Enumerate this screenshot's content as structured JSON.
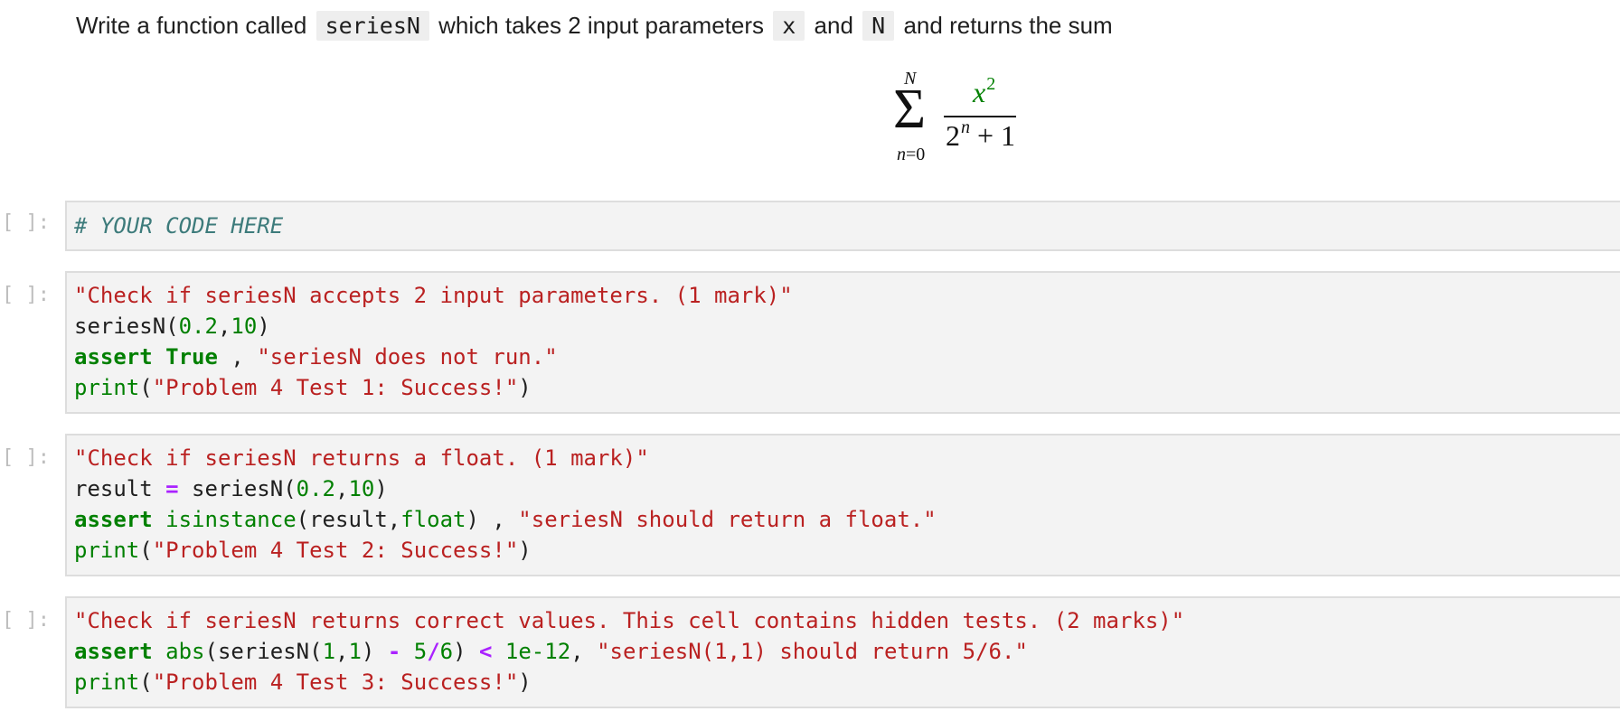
{
  "markdown": {
    "text_1": "Write a function called",
    "code_1": "seriesN",
    "text_2": "which takes 2 input parameters",
    "code_2": "x",
    "text_3": "and",
    "code_3": "N",
    "text_4": "and returns the sum"
  },
  "formula": {
    "sigma": "Σ",
    "upper_limit": "N",
    "lower_limit_var": "n",
    "lower_limit_eq": "=0",
    "numerator_base": "x",
    "numerator_exp": "2",
    "denominator_base": "2",
    "denominator_exp": "n",
    "denominator_rest": "+ 1"
  },
  "cells": [
    {
      "prompt": "[ ]:",
      "lines": [
        {
          "tokens": [
            {
              "t": "# YOUR CODE HERE",
              "c": "cm"
            }
          ]
        }
      ]
    },
    {
      "prompt": "[ ]:",
      "lines": [
        {
          "tokens": [
            {
              "t": "\"Check if seriesN accepts 2 input parameters. (1 mark)\"",
              "c": "str"
            }
          ]
        },
        {
          "tokens": [
            {
              "t": "seriesN(",
              "c": ""
            },
            {
              "t": "0.2",
              "c": "num"
            },
            {
              "t": ",",
              "c": ""
            },
            {
              "t": "10",
              "c": "num"
            },
            {
              "t": ")",
              "c": ""
            }
          ]
        },
        {
          "tokens": [
            {
              "t": "assert",
              "c": "kw"
            },
            {
              "t": " ",
              "c": ""
            },
            {
              "t": "True",
              "c": "kw"
            },
            {
              "t": " , ",
              "c": ""
            },
            {
              "t": "\"seriesN does not run.\"",
              "c": "str"
            }
          ]
        },
        {
          "tokens": [
            {
              "t": "print",
              "c": "bi"
            },
            {
              "t": "(",
              "c": ""
            },
            {
              "t": "\"Problem 4 Test 1: Success!\"",
              "c": "str"
            },
            {
              "t": ")",
              "c": ""
            }
          ]
        }
      ]
    },
    {
      "prompt": "[ ]:",
      "lines": [
        {
          "tokens": [
            {
              "t": "\"Check if seriesN returns a float. (1 mark)\"",
              "c": "str"
            }
          ]
        },
        {
          "tokens": [
            {
              "t": "result ",
              "c": ""
            },
            {
              "t": "=",
              "c": "op"
            },
            {
              "t": " seriesN(",
              "c": ""
            },
            {
              "t": "0.2",
              "c": "num"
            },
            {
              "t": ",",
              "c": ""
            },
            {
              "t": "10",
              "c": "num"
            },
            {
              "t": ")",
              "c": ""
            }
          ]
        },
        {
          "tokens": [
            {
              "t": "assert",
              "c": "kw"
            },
            {
              "t": " ",
              "c": ""
            },
            {
              "t": "isinstance",
              "c": "bi"
            },
            {
              "t": "(result,",
              "c": ""
            },
            {
              "t": "float",
              "c": "bi"
            },
            {
              "t": ") , ",
              "c": ""
            },
            {
              "t": "\"seriesN should return a float.\"",
              "c": "str"
            }
          ]
        },
        {
          "tokens": [
            {
              "t": "print",
              "c": "bi"
            },
            {
              "t": "(",
              "c": ""
            },
            {
              "t": "\"Problem 4 Test 2: Success!\"",
              "c": "str"
            },
            {
              "t": ")",
              "c": ""
            }
          ]
        }
      ]
    },
    {
      "prompt": "[ ]:",
      "lines": [
        {
          "tokens": [
            {
              "t": "\"Check if seriesN returns correct values. This cell contains hidden tests. (2 marks)\"",
              "c": "str"
            }
          ]
        },
        {
          "tokens": [
            {
              "t": "assert",
              "c": "kw"
            },
            {
              "t": " ",
              "c": ""
            },
            {
              "t": "abs",
              "c": "bi"
            },
            {
              "t": "(seriesN(",
              "c": ""
            },
            {
              "t": "1",
              "c": "num"
            },
            {
              "t": ",",
              "c": ""
            },
            {
              "t": "1",
              "c": "num"
            },
            {
              "t": ") ",
              "c": ""
            },
            {
              "t": "-",
              "c": "op"
            },
            {
              "t": " ",
              "c": ""
            },
            {
              "t": "5",
              "c": "num"
            },
            {
              "t": "/",
              "c": "op"
            },
            {
              "t": "6",
              "c": "num"
            },
            {
              "t": ") ",
              "c": ""
            },
            {
              "t": "<",
              "c": "op"
            },
            {
              "t": " ",
              "c": ""
            },
            {
              "t": "1e-12",
              "c": "num"
            },
            {
              "t": ", ",
              "c": ""
            },
            {
              "t": "\"seriesN(1,1) should return 5/6.\"",
              "c": "str"
            }
          ]
        },
        {
          "tokens": [
            {
              "t": "print",
              "c": "bi"
            },
            {
              "t": "(",
              "c": ""
            },
            {
              "t": "\"Problem 4 Test 3: Success!\"",
              "c": "str"
            },
            {
              "t": ")",
              "c": ""
            }
          ]
        }
      ]
    }
  ]
}
